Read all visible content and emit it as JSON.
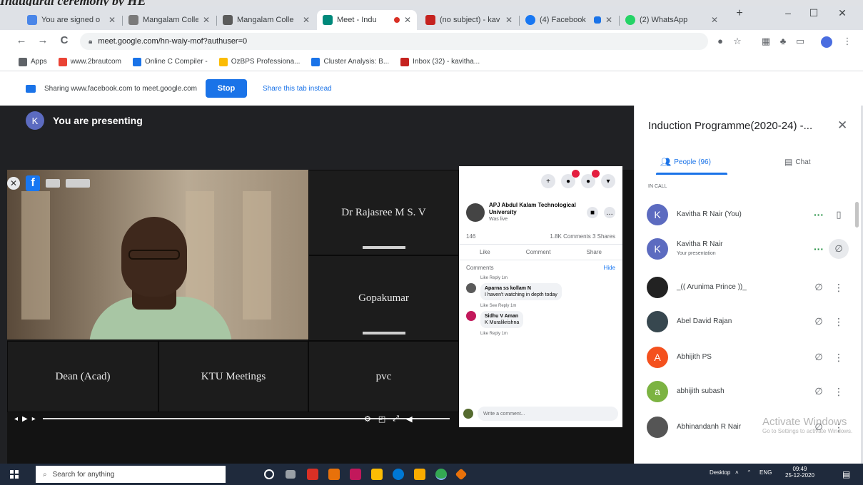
{
  "caption": "Inaugural ceremony by HE",
  "browser": {
    "tabs": [
      {
        "title": "You are signed o",
        "fav": "#4a86e8"
      },
      {
        "title": "Mangalam Colleg",
        "fav": "#7a7a7a"
      },
      {
        "title": "Mangalam Colle",
        "fav": "#5b5b5b"
      },
      {
        "title": "Meet - Indu",
        "fav": "#00897b",
        "active": true,
        "recording": true
      },
      {
        "title": "(no subject) - kav",
        "fav": "#c5221f"
      },
      {
        "title": "(4) Facebook",
        "fav": "#1877f2",
        "notif": "#1a73e8"
      },
      {
        "title": "(2) WhatsApp",
        "fav": "#25d366"
      }
    ],
    "new_tab": "+",
    "win_min": "–",
    "win_max": "☐",
    "win_close": "✕",
    "back": "←",
    "forward": "→",
    "reload": "C",
    "url": "meet.google.com/hn-waiy-mof?authuser=0",
    "bookmarks": [
      {
        "label": "Apps",
        "color": "#5f6368"
      },
      {
        "label": "www.2brautcom",
        "color": "#ea4335"
      },
      {
        "label": "Online C Compiler -",
        "color": "#1a73e8"
      },
      {
        "label": "OzBPS Professiona...",
        "color": "#fbbc04"
      },
      {
        "label": "Cluster Analysis: B...",
        "color": "#1a73e8"
      },
      {
        "label": "Inbox (32) - kavitha...",
        "color": "#c5221f"
      }
    ]
  },
  "sharebar": {
    "text": "Sharing www.facebook.com to meet.google.com",
    "stop": "Stop",
    "hide": "Share this tab instead"
  },
  "meet": {
    "presenter_initial": "K",
    "presenting": "You are presenting",
    "tiles": {
      "t1": "Dr Rajasree M S. V",
      "t2": "Gopakumar",
      "t3": "Dean (Acad)",
      "t4": "KTU Meetings",
      "t5": "pvc"
    },
    "video_fb": "f",
    "video_close": "✕",
    "fb": {
      "page_name": "APJ Abdul Kalam Technological University",
      "page_meta": "Was live",
      "reactions": "146",
      "stats": "1.8K Comments  3 Shares",
      "like": "Like",
      "comment": "Comment",
      "share": "Share",
      "comments_label": "Comments",
      "hide": "Hide",
      "c1_meta": "Like  Reply  1m",
      "c2_name": "Aparna ss kollam N",
      "c2_text": "I haven't watching in depth today",
      "c2_meta": "Like  See Reply  1m",
      "c3_name": "Sidhu V Aman",
      "c3_text": "K Muralikrishna",
      "c3_meta": "Like  Reply  1m",
      "write": "Write a comment..."
    }
  },
  "panel": {
    "title": "Induction Programme(2020-24) -...",
    "close": "✕",
    "tab_people": "People (96)",
    "tab_chat": "Chat",
    "in_call": "IN CALL",
    "people": [
      {
        "initial": "K",
        "color": "#5c6bc0",
        "name": "Kavitha R Nair (You)",
        "sub": "",
        "dots": true,
        "icon": "▯"
      },
      {
        "initial": "K",
        "color": "#5c6bc0",
        "name": "Kavitha R Nair",
        "sub": "Your presentation",
        "dots": true,
        "icon": "∅"
      },
      {
        "initial": "",
        "color": "#222",
        "name": "_(( Arunima Prince ))_",
        "sub": "",
        "dots": false,
        "icon": "∅"
      },
      {
        "initial": "",
        "color": "#37474f",
        "name": "Abel David Rajan",
        "sub": "",
        "dots": false,
        "icon": "∅"
      },
      {
        "initial": "A",
        "color": "#f4511e",
        "name": "Abhijith PS",
        "sub": "",
        "dots": false,
        "icon": "∅"
      },
      {
        "initial": "a",
        "color": "#7cb342",
        "name": "abhijith subash",
        "sub": "",
        "dots": false,
        "icon": "∅"
      },
      {
        "initial": "",
        "color": "#555",
        "name": "Abhinandanh R Nair",
        "sub": "",
        "dots": false,
        "icon": "∅"
      }
    ],
    "watermark_1": "Activate Windows",
    "watermark_2": "Go to Settings to activate Windows."
  },
  "taskbar": {
    "search": "Search for anything",
    "desktop": "Desktop",
    "lang": "ENG",
    "time": "09:49",
    "date": "25-12-2020"
  }
}
